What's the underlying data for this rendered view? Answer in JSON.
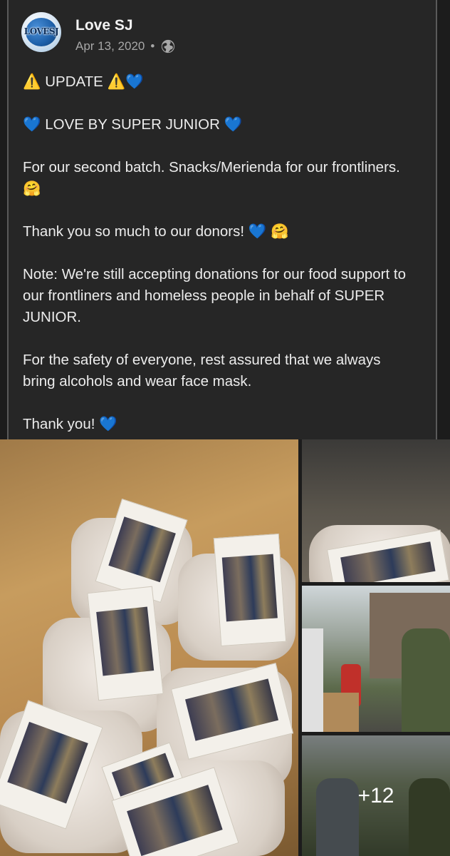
{
  "post": {
    "author": "Love SJ",
    "avatar_text": "LOVESJ",
    "date": "Apr 13, 2020",
    "separator": "•",
    "privacy_icon": "globe-icon",
    "lines": {
      "update": "⚠️ UPDATE ⚠️💙",
      "headline": "💙 LOVE BY SUPER JUNIOR 💙",
      "batch": "For our second batch. Snacks/Merienda for our frontliners. 🤗",
      "thanks_donors": "Thank you so much to our donors! 💙 🤗",
      "note": "Note: We're still accepting donations for our food support to our frontliners and homeless people in behalf of SUPER JUNIOR.",
      "safety": "For the safety of everyone, rest assured that we always bring alcohols and wear face mask.",
      "thank_you": "Thank you! 💙"
    }
  },
  "photos": {
    "more_count": "+12"
  },
  "colors": {
    "background": "#1c1c1c",
    "card": "#262626",
    "text": "#ececec",
    "meta": "#a7a7a7"
  }
}
